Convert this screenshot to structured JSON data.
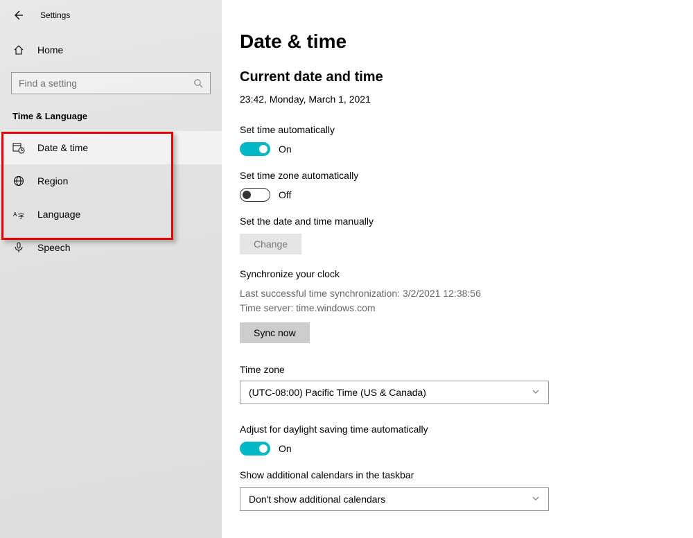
{
  "top": {
    "title": "Settings"
  },
  "sidebar": {
    "home": "Home",
    "search_placeholder": "Find a setting",
    "section": "Time & Language",
    "items": [
      {
        "label": "Date & time",
        "active": true
      },
      {
        "label": "Region",
        "active": false
      },
      {
        "label": "Language",
        "active": false
      },
      {
        "label": "Speech",
        "active": false
      }
    ]
  },
  "main": {
    "title": "Date & time",
    "current_header": "Current date and time",
    "current_value": "23:42, Monday, March 1, 2021",
    "auto_time": {
      "label": "Set time automatically",
      "state": "On",
      "on": true
    },
    "auto_tz": {
      "label": "Set time zone automatically",
      "state": "Off",
      "on": false
    },
    "manual": {
      "label": "Set the date and time manually",
      "button": "Change"
    },
    "sync": {
      "header": "Synchronize your clock",
      "last": "Last successful time synchronization: 3/2/2021 12:38:56",
      "server": "Time server: time.windows.com",
      "button": "Sync now"
    },
    "tz": {
      "label": "Time zone",
      "value": "(UTC-08:00) Pacific Time (US & Canada)"
    },
    "dst": {
      "label": "Adjust for daylight saving time automatically",
      "state": "On",
      "on": true
    },
    "calendars": {
      "label": "Show additional calendars in the taskbar",
      "value": "Don't show additional calendars"
    }
  }
}
